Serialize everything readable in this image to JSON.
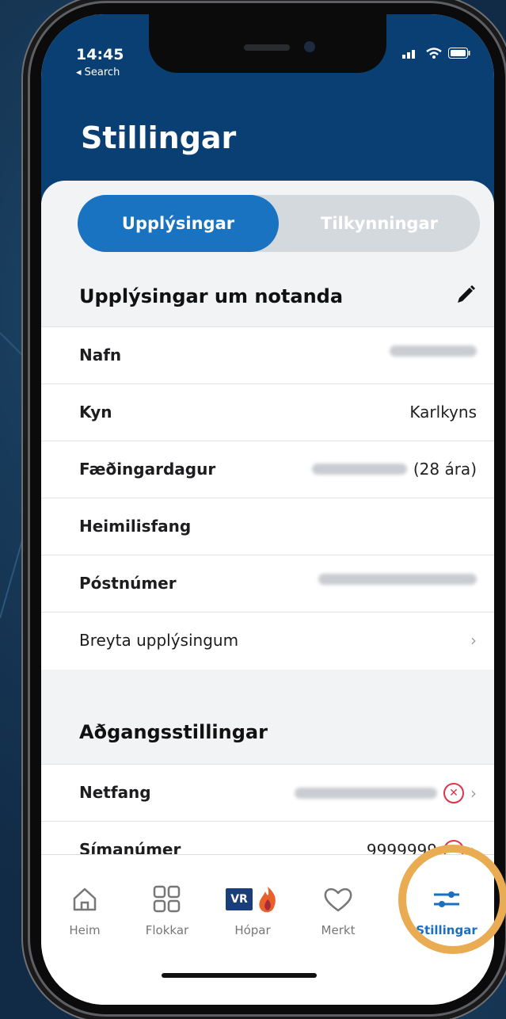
{
  "status_bar": {
    "time": "14:45",
    "back_label": "◂ Search"
  },
  "page_title": "Stillingar",
  "segments": {
    "info": "Upplýsingar",
    "notifications": "Tilkynningar"
  },
  "user_section": {
    "heading": "Upplýsingar um notanda",
    "rows": [
      {
        "label": "Nafn",
        "value": ""
      },
      {
        "label": "Kyn",
        "value": "Karlkyns"
      },
      {
        "label": "Fæðingardagur",
        "value": "(28 ára)"
      },
      {
        "label": "Heimilisfang",
        "value": ""
      },
      {
        "label": "Póstnúmer",
        "value": ""
      }
    ],
    "edit_link": "Breyta upplýsingum"
  },
  "access_section": {
    "heading": "Aðgangsstillingar",
    "rows": [
      {
        "label": "Netfang",
        "value": ""
      },
      {
        "label": "Símanúmer",
        "value": "9999999"
      }
    ]
  },
  "tabbar": {
    "home": "Heim",
    "categories": "Flokkar",
    "groups": "Hópar",
    "group_badge": "VR",
    "marked": "Merkt",
    "settings": "Stillingar"
  },
  "colors": {
    "header": "#0a3f73",
    "accent": "#1a73c0",
    "highlight_ring": "#e9ac52",
    "error": "#e0334a"
  }
}
